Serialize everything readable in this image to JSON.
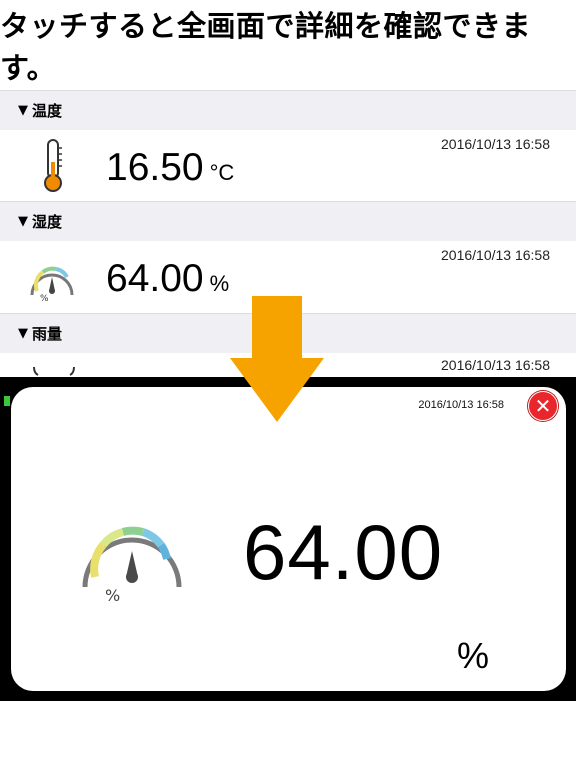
{
  "headline": "タッチすると全画面で詳細を確認できます。",
  "sections": [
    {
      "label": "温度",
      "timestamp": "2016/10/13 16:58",
      "value": "16.50",
      "unit": "°C",
      "icon": "thermometer-icon"
    },
    {
      "label": "湿度",
      "timestamp": "2016/10/13 16:58",
      "value": "64.00",
      "unit": "%",
      "icon": "humidity-gauge-icon"
    },
    {
      "label": "雨量",
      "timestamp": "2016/10/13 16:58",
      "icon": "rain-icon"
    }
  ],
  "triangle": "▼",
  "fullscreen": {
    "timestamp": "2016/10/13 16:58",
    "value": "64.00",
    "unit": "%",
    "gauge_label": "%",
    "close_icon": "close-icon",
    "gauge_icon": "humidity-gauge-icon"
  },
  "colors": {
    "accent_arrow": "#f6a300",
    "close": "#e8262b",
    "thermometer": "#f08a00",
    "status_green": "#3cc63c"
  }
}
